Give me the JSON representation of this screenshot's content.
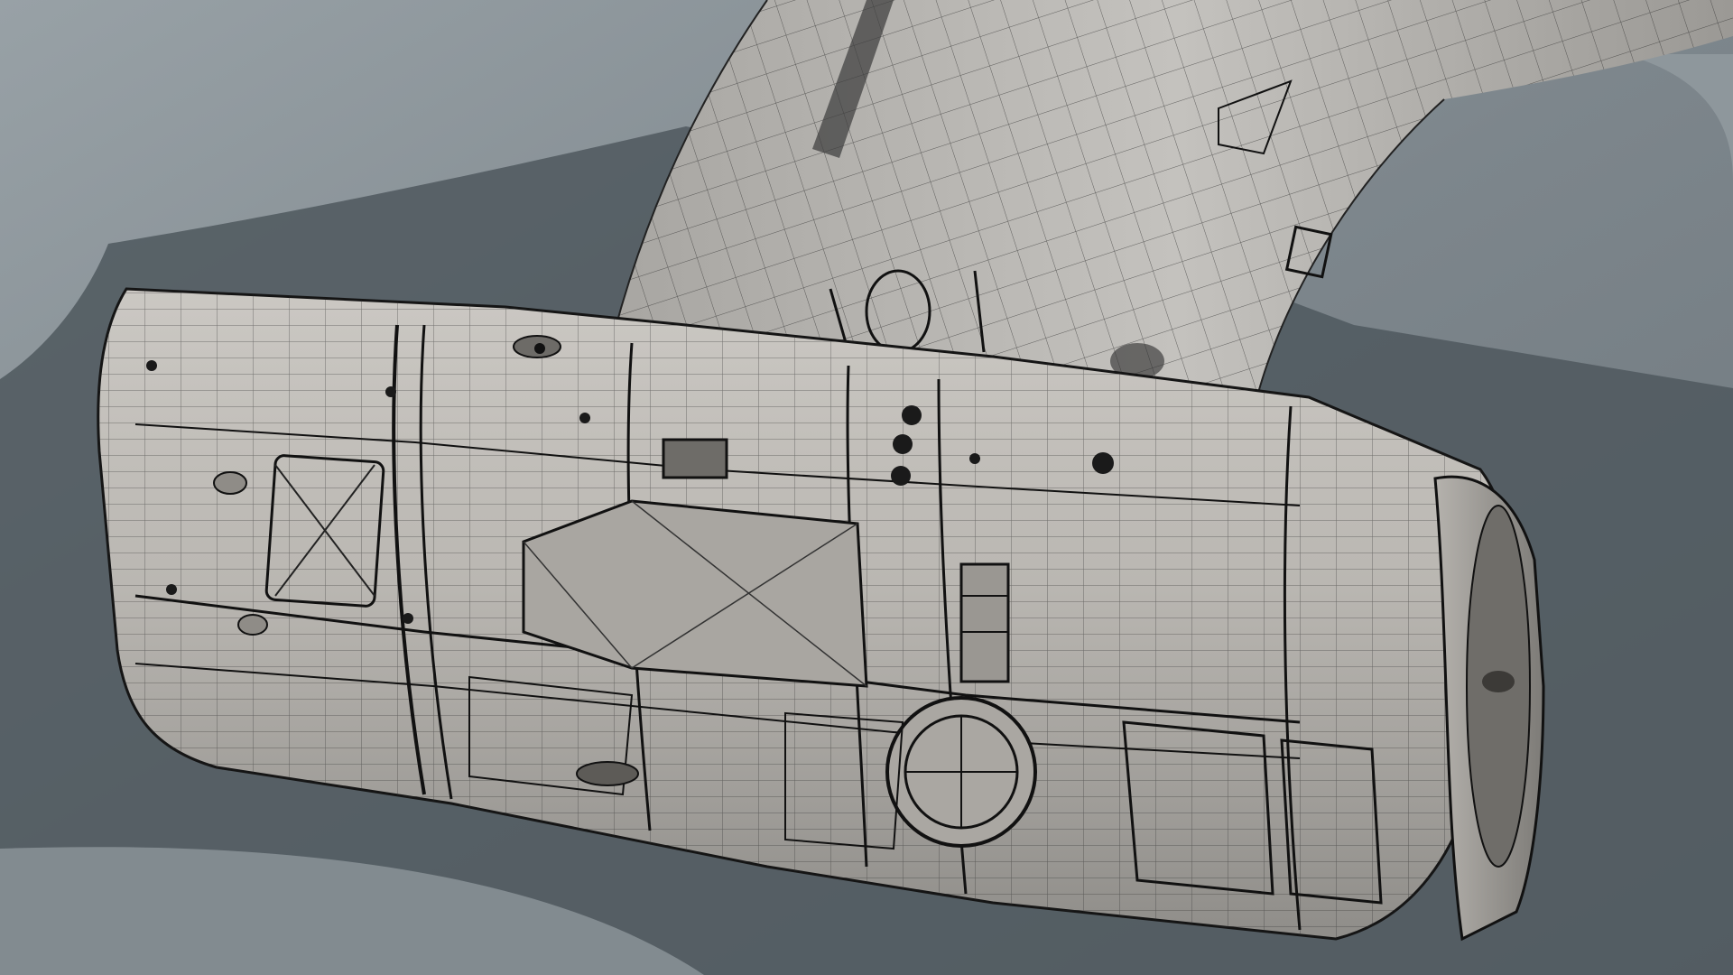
{
  "scene": {
    "subject": "wireframe-shaded-mechanical-part",
    "background_color": "#7c858b",
    "shadow_color": "#4a5359",
    "surface_color": "#bdbab5",
    "wire_color": "#1a1a1a"
  }
}
